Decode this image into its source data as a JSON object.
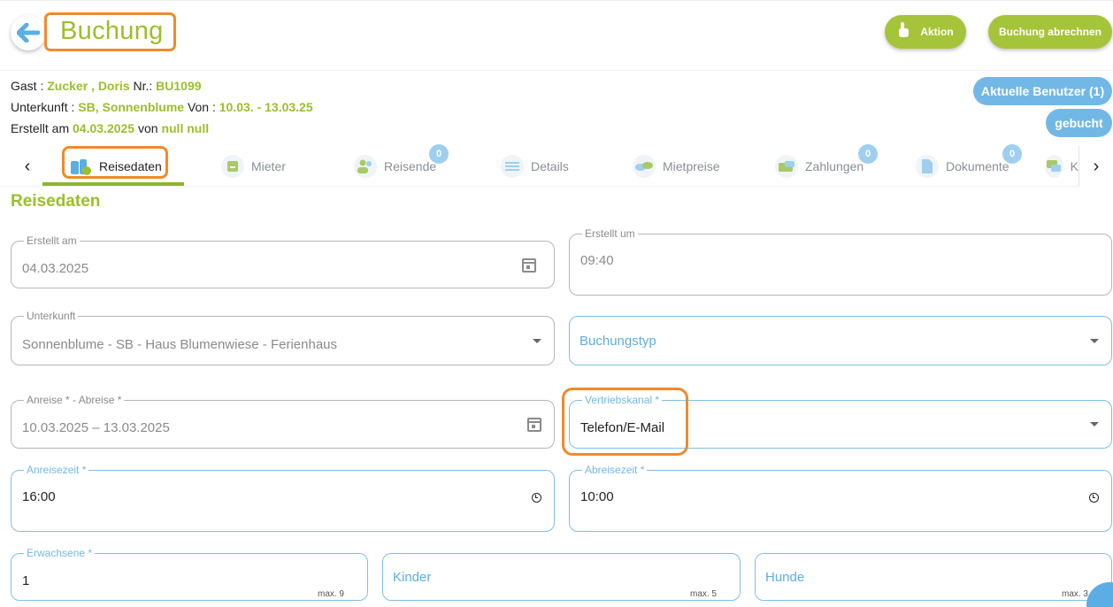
{
  "header": {
    "title": "Buchung",
    "aktion_label": "Aktion",
    "abrechnen_label": "Buchung abrechnen"
  },
  "info": {
    "gast_label": "Gast : ",
    "gast_value": "Zucker , Doris",
    "nr_label": " Nr.: ",
    "nr_value": "BU1099",
    "unterkunft_label": "Unterkunft : ",
    "unterkunft_value": "SB, Sonnenblume",
    "von_label": " Von : ",
    "von_value": "10.03. - 13.03.25",
    "erstellt_label": "Erstellt am ",
    "erstellt_value": "04.03.2025",
    "von2_label": " von ",
    "von2_value": "null null"
  },
  "status": {
    "users_label": "Aktuelle Benutzer (1)",
    "booked_label": "gebucht"
  },
  "tabs": [
    {
      "label": "Reisedaten",
      "icon": "luggage-icon"
    },
    {
      "label": "Mieter",
      "icon": "contact-icon"
    },
    {
      "label": "Reisende",
      "icon": "people-icon",
      "badge": "0"
    },
    {
      "label": "Details",
      "icon": "list-icon"
    },
    {
      "label": "Mietpreise",
      "icon": "coins-icon"
    },
    {
      "label": "Zahlungen",
      "icon": "payment-icon",
      "badge": "0"
    },
    {
      "label": "Dokumente",
      "icon": "document-icon",
      "badge": "0"
    },
    {
      "label": "K",
      "icon": "chat-icon"
    }
  ],
  "section": {
    "title": "Reisedaten"
  },
  "form": {
    "erstellt_am": {
      "label": "Erstellt am",
      "value": "04.03.2025"
    },
    "erstellt_um": {
      "label": "Erstellt um",
      "value": "09:40"
    },
    "unterkunft": {
      "label": "Unterkunft",
      "value": "Sonnenblume - SB - Haus Blumenwiese - Ferienhaus"
    },
    "buchungstyp": {
      "placeholder": "Buchungstyp"
    },
    "reisezeitraum": {
      "label": "Anreise * - Abreise *",
      "value": "10.03.2025 – 13.03.2025"
    },
    "vertriebskanal": {
      "label": "Vertriebskanal *",
      "value": "Telefon/E-Mail"
    },
    "anreisezeit": {
      "label": "Anreisezeit *",
      "value": "16:00"
    },
    "abreisezeit": {
      "label": "Abreisezeit *",
      "value": "10:00"
    },
    "erwachsene": {
      "label": "Erwachsene *",
      "value": "1",
      "max": "max. 9"
    },
    "kinder": {
      "placeholder": "Kinder",
      "max": "max. 5"
    },
    "hunde": {
      "placeholder": "Hunde",
      "max": "max. 3"
    }
  },
  "colors": {
    "accent_green": "#9bbf2a",
    "accent_blue": "#72b8e6",
    "highlight_orange": "#f08a2c"
  }
}
